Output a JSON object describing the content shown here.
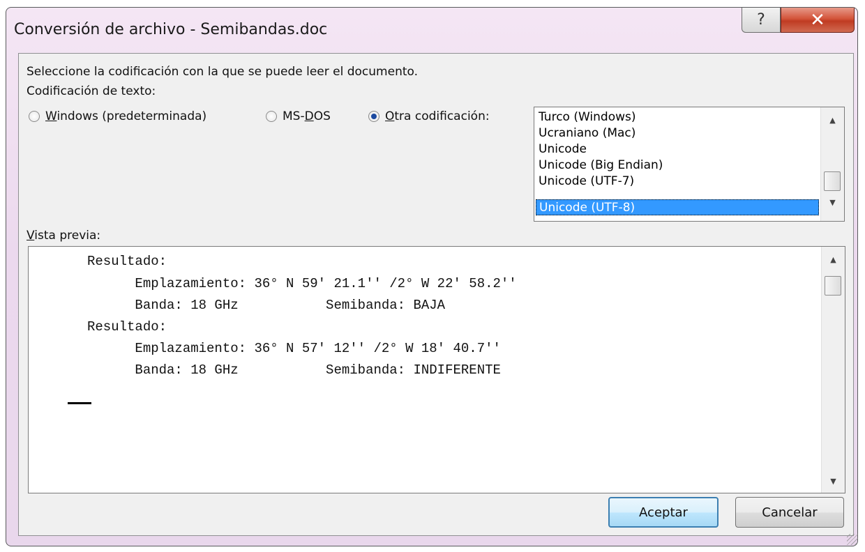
{
  "window": {
    "title": "Conversión de archivo - Semibandas.doc",
    "help_glyph": "?",
    "close_glyph": "✕"
  },
  "dialog": {
    "instruction": "Seleccione la codificación con la que se puede leer el documento.",
    "encoding_label": "Codificación de texto:",
    "radios": [
      {
        "label": "Windows (predeterminada)",
        "accel": "W",
        "rest": "indows (predeterminada)",
        "selected": false
      },
      {
        "label": "MS-DOS",
        "pre": "MS-",
        "accel": "D",
        "rest": "OS",
        "selected": false
      },
      {
        "label": "Otra codificación:",
        "accel": "O",
        "rest": "tra codificación:",
        "selected": true
      }
    ],
    "encodings": [
      "Turco (Windows)",
      "Ucraniano (Mac)",
      "Unicode",
      "Unicode (Big Endian)",
      "Unicode (UTF-7)",
      "Unicode (UTF-8)"
    ],
    "selected_encoding": "Unicode (UTF-8)",
    "preview_label": "Vista previa:",
    "preview_label_accel": "V",
    "preview_label_rest": "ista previa:",
    "preview_lines": [
      "Resultado:",
      "      Emplazamiento: 36° N 59' 21.1'' /2° W 22' 58.2''",
      "      Banda: 18 GHz           Semibanda: BAJA",
      "Resultado:",
      "      Emplazamiento: 36° N 57' 12'' /2° W 18' 40.7''",
      "      Banda: 18 GHz           Semibanda: INDIFERENTE"
    ],
    "ok_label": "Aceptar",
    "cancel_label": "Cancelar"
  },
  "colors": {
    "selection": "#3399ff",
    "close_button": "#c8452c",
    "frame": "#ecd9ee"
  }
}
